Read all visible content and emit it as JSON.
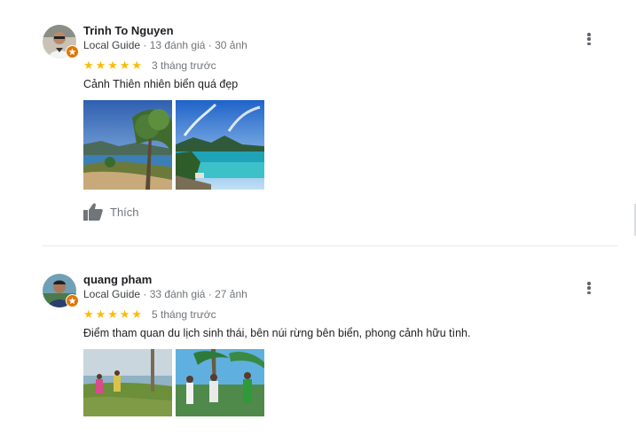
{
  "reviews": [
    {
      "name": "Trinh To Nguyen",
      "guide_label": "Local Guide",
      "meta": " · 13 đánh giá · 30 ảnh",
      "rating": 5,
      "stars": [
        "★",
        "★",
        "★",
        "★",
        "★"
      ],
      "time": "3 tháng trước",
      "text": "Cảnh Thiên nhiên biển quá đẹp",
      "like_label": "Thích"
    },
    {
      "name": "quang pham",
      "guide_label": "Local Guide",
      "meta": " · 33 đánh giá · 27 ảnh",
      "rating": 5,
      "stars": [
        "★",
        "★",
        "★",
        "★",
        "★"
      ],
      "time": "5 tháng trước",
      "text": "Điểm tham quan du lịch sinh thái, bên núi rừng bên biển, phong cảnh hữu tình."
    }
  ],
  "colors": {
    "star": "#fbbc04",
    "badge": "#e37400",
    "secondary_text": "#70757a",
    "primary_text": "#202124"
  },
  "icons": {
    "more": "more-vert-icon",
    "like": "thumb-up-icon",
    "badge": "local-guide-badge-icon"
  }
}
